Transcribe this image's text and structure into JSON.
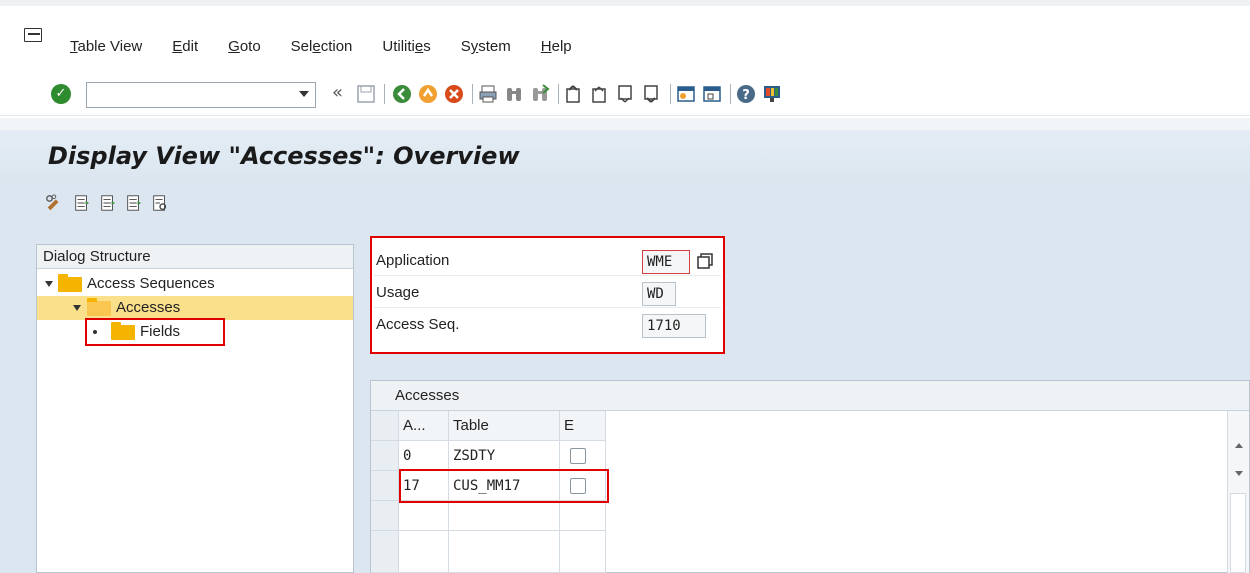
{
  "menu": {
    "items": [
      {
        "pre": "",
        "u": "T",
        "post": "able View"
      },
      {
        "pre": "",
        "u": "E",
        "post": "dit"
      },
      {
        "pre": "",
        "u": "G",
        "post": "oto"
      },
      {
        "pre": "Sel",
        "u": "e",
        "post": "ction"
      },
      {
        "pre": "Utiliti",
        "u": "e",
        "post": "s"
      },
      {
        "pre": "S",
        "u": "y",
        "post": "stem"
      },
      {
        "pre": "",
        "u": "H",
        "post": "elp"
      }
    ]
  },
  "toolbar": {
    "command_field_value": "",
    "back_glyph": "«"
  },
  "page_title": "Display View \"Accesses\": Overview",
  "dialog_structure": {
    "title": "Dialog Structure",
    "nodes": [
      {
        "label": "Access Sequences",
        "icon": "folder-icon"
      },
      {
        "label": "Accesses",
        "icon": "folder-open-icon",
        "selected": true
      },
      {
        "label": "Fields",
        "icon": "folder-icon"
      }
    ]
  },
  "header_fields": {
    "application": {
      "label": "Application",
      "value": "WME"
    },
    "usage": {
      "label": "Usage",
      "value": "WD"
    },
    "access_seq": {
      "label": "Access Seq.",
      "value": "1710"
    }
  },
  "accesses_table": {
    "title": "Accesses",
    "columns": [
      "A...",
      "Table",
      "E"
    ],
    "rows": [
      {
        "access": "0",
        "table": "ZSDTY",
        "exclusive": false
      },
      {
        "access": "17",
        "table": "CUS_MM17",
        "exclusive": false
      }
    ]
  },
  "colors": {
    "highlight": "#e00000",
    "workarea": "#dbe6f0",
    "selection": "#fbe08c",
    "folder": "#f5b400"
  }
}
